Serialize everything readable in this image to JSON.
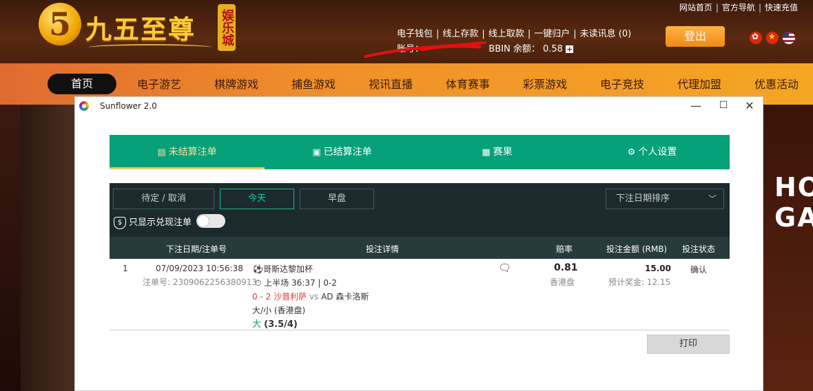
{
  "site": {
    "logo_number": "5",
    "logo_name": "九五至尊",
    "logo_badge": "娱乐城",
    "top_links": [
      "网站首页",
      "官方导航",
      "快速充值"
    ],
    "account_links": [
      "电子钱包",
      "线上存款",
      "线上取款",
      "一键归户",
      "未读讯息 (0)"
    ],
    "account_label": "账号：",
    "balance_label": "BBIN 余额：",
    "balance_value": "0.58",
    "logout_label": "登出",
    "nav": [
      "首页",
      "电子游艺",
      "棋牌游戏",
      "捕鱼游戏",
      "视讯直播",
      "体育赛事",
      "彩票游戏",
      "电子竞技",
      "代理加盟",
      "优惠活动"
    ],
    "banner_text": [
      "HOT",
      "GAM"
    ]
  },
  "window": {
    "title": "Sunflower 2.0",
    "minimize": "—",
    "maximize": "☐",
    "close": "✕"
  },
  "tabs": [
    {
      "icon": "▤",
      "label": "未结算注单"
    },
    {
      "icon": "▣",
      "label": "已结算注单"
    },
    {
      "icon": "▦",
      "label": "赛果"
    },
    {
      "icon": "⚙",
      "label": "个人设置"
    }
  ],
  "filters": {
    "pending": "待定 / 取消",
    "today": "今天",
    "early": "早盘",
    "sort": "下注日期排序",
    "cashout_only": "只显示兑现注单"
  },
  "table": {
    "headers": [
      "下注日期/注单号",
      "投注详情",
      "赔率",
      "投注金额 (RMB)",
      "投注状态"
    ],
    "rows": [
      {
        "index": "1",
        "date": "07/09/2023 10:56:38",
        "bet_no_label": "注单号: ",
        "bet_no": "2309062256380913",
        "league": "哥斯达黎加杯",
        "period": "上半场 36:37",
        "period_score": "0-2",
        "score": "0 - 2",
        "home": "沙普利萨",
        "vs": "vs",
        "away": "AD 森卡洛斯",
        "market": "大/小 (香港盘)",
        "pick": "大",
        "line": "(3.5/4)",
        "odds": "0.81",
        "odds_type": "香港盘",
        "stake": "15.00",
        "payout_label": "预计奖金: ",
        "payout": "12.15",
        "status": "确认"
      }
    ]
  },
  "print_label": "打印",
  "colors": {
    "tab_green": "#06a079",
    "panel_dark": "#1b2b2d",
    "nav_orange": "#f0902a",
    "score_red": "#e53935"
  }
}
